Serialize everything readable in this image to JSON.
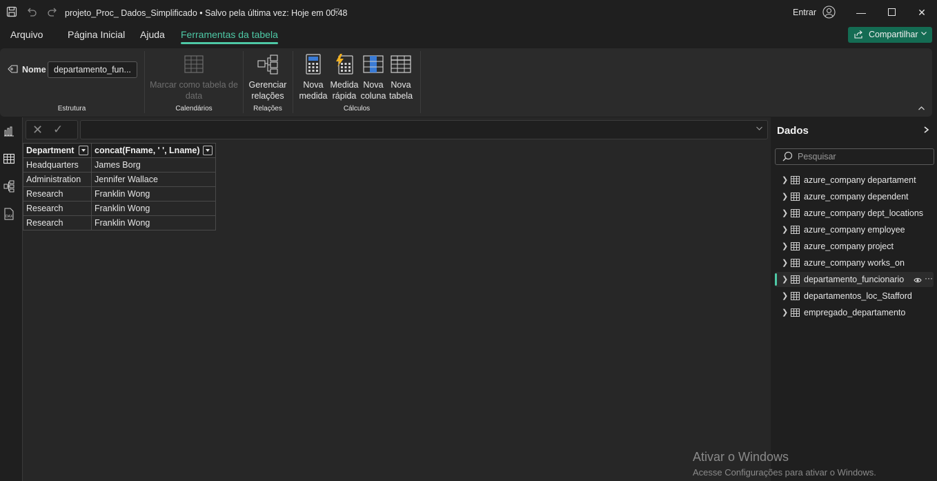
{
  "titlebar": {
    "document_title": "projeto_Proc_ Dados_Simplificado",
    "save_status": "• Salvo pela última vez: Hoje em 00:48",
    "signin_label": "Entrar"
  },
  "menu": {
    "tabs": [
      "Arquivo",
      "Página Inicial",
      "Ajuda",
      "Ferramentas da tabela"
    ],
    "active_tab": "Ferramentas da tabela",
    "share_label": "Compartilhar"
  },
  "ribbon": {
    "name_label": "Nome",
    "name_value": "departamento_fun...",
    "mark_date_table": [
      "Marcar como tabela de",
      "data"
    ],
    "manage_relations": [
      "Gerenciar",
      "relações"
    ],
    "new_measure": [
      "Nova",
      "medida"
    ],
    "quick_measure": [
      "Medida",
      "rápida"
    ],
    "new_column": [
      "Nova",
      "coluna"
    ],
    "new_table": [
      "Nova",
      "tabela"
    ],
    "groups": {
      "structure": "Estrutura",
      "calendars": "Calendários",
      "relations": "Relações",
      "calculations": "Cálculos"
    }
  },
  "table_view": {
    "columns": [
      "Department",
      "concat(Fname, ' ', Lname)"
    ],
    "rows": [
      [
        "Headquarters",
        "James Borg"
      ],
      [
        "Administration",
        "Jennifer Wallace"
      ],
      [
        "Research",
        "Franklin Wong"
      ],
      [
        "Research",
        "Franklin Wong"
      ],
      [
        "Research",
        "Franklin Wong"
      ]
    ]
  },
  "data_pane": {
    "title": "Dados",
    "search_placeholder": "Pesquisar",
    "tables": [
      "azure_company departament",
      "azure_company dependent",
      "azure_company dept_locations",
      "azure_company employee",
      "azure_company project",
      "azure_company works_on",
      "departamento_funcionario",
      "departamentos_loc_Stafford",
      "empregado_departamento"
    ],
    "selected_table": "departamento_funcionario"
  },
  "watermark": {
    "title": "Ativar o Windows",
    "subtitle": "Acesse Configurações para ativar o Windows."
  },
  "colors": {
    "accent": "#4ec9a6",
    "share_button": "#146c53",
    "background": "#1f1f1f",
    "ribbon": "#2b2b2b"
  },
  "icons": {
    "save": "save-icon",
    "undo": "undo-icon",
    "redo": "redo-icon",
    "report_view": "report-view-icon",
    "table_view": "table-view-icon",
    "model_view": "model-view-icon",
    "dax_view": "dax-query-icon"
  }
}
